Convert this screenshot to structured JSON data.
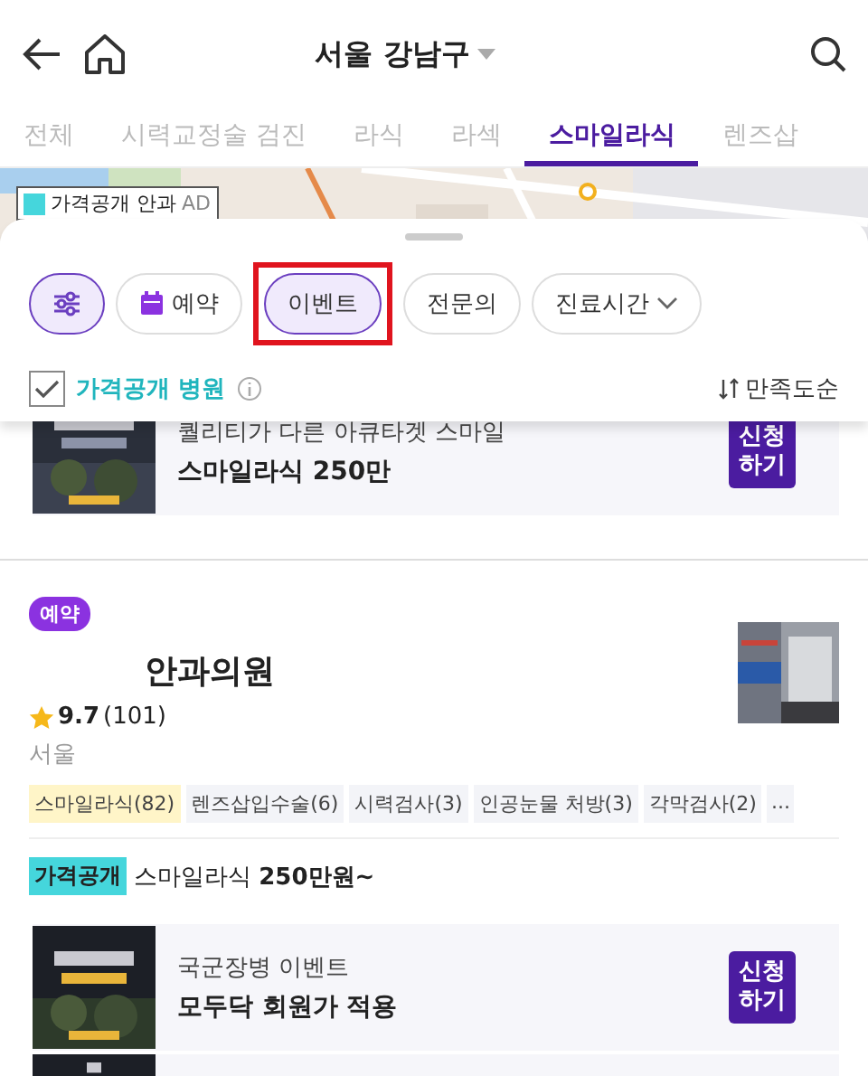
{
  "header": {
    "location": "서울 강남구"
  },
  "tabs": [
    {
      "label": "전체",
      "selected": false
    },
    {
      "label": "시력교정술 검진",
      "selected": false
    },
    {
      "label": "라식",
      "selected": false
    },
    {
      "label": "라섹",
      "selected": false
    },
    {
      "label": "스마일라식",
      "selected": true
    },
    {
      "label": "렌즈삽",
      "selected": false
    }
  ],
  "map": {
    "kind": "picture",
    "legend": "가격공개 안과",
    "ad": "AD"
  },
  "filters": {
    "chips": [
      {
        "kind": "settings",
        "selected": true,
        "highlighted": false
      },
      {
        "kind": "calendar",
        "label": "예약",
        "selected": false,
        "highlighted": false
      },
      {
        "kind": "text",
        "label": "이벤트",
        "selected": true,
        "highlighted": true
      },
      {
        "kind": "text",
        "label": "전문의",
        "selected": false,
        "highlighted": false
      },
      {
        "kind": "dropdown",
        "label": "진료시간",
        "selected": false,
        "highlighted": false
      }
    ],
    "price_open": {
      "label": "가격공개 병원",
      "checked": true
    },
    "sort": "만족도순"
  },
  "top_event": {
    "title": "퀄리티가 다른 아큐타겟 스마일",
    "subtitle": "스마일라식 250만",
    "button": "신청하기"
  },
  "clinic": {
    "badge": "예약",
    "name": "안과의원",
    "rating": "9.7",
    "reviews": "(101)",
    "region": "서울",
    "tags": [
      {
        "label": "스마일라식(82)",
        "matched": true
      },
      {
        "label": "렌즈삽입수술(6)",
        "matched": false
      },
      {
        "label": "시력검사(3)",
        "matched": false
      },
      {
        "label": "인공눈물 처방(3)",
        "matched": false
      },
      {
        "label": "각막검사(2)",
        "matched": false
      }
    ],
    "more": "...",
    "price_tag": "가격공개",
    "price_text": "스마일라식 **250만원~**",
    "events": [
      {
        "title": "국군장병 이벤트",
        "subtitle": "모두닥 회원가 적용",
        "button": "신청하기"
      }
    ]
  }
}
